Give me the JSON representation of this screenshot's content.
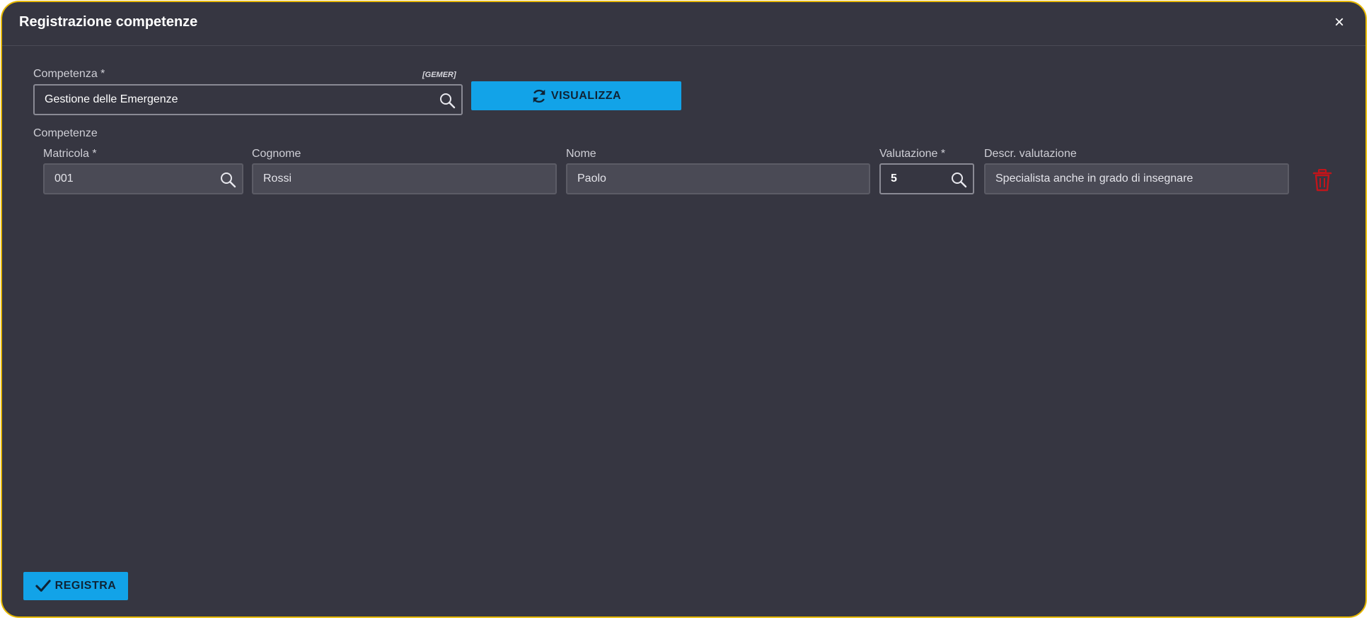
{
  "dialog": {
    "title": "Registrazione competenze",
    "close_label": "×"
  },
  "competenza": {
    "label": "Competenza *",
    "code": "[GEMER]",
    "value": "Gestione delle Emergenze",
    "search_icon": "search-icon"
  },
  "visualizza_button": {
    "label": "VISUALIZZA",
    "icon": "refresh-icon"
  },
  "section_label": "Competenze",
  "row": {
    "matricola": {
      "label": "Matricola *",
      "value": "001"
    },
    "cognome": {
      "label": "Cognome",
      "value": "Rossi"
    },
    "nome": {
      "label": "Nome",
      "value": "Paolo"
    },
    "valutazione": {
      "label": "Valutazione *",
      "value": "5"
    },
    "descr": {
      "label": "Descr. valutazione",
      "value": "Specialista anche in grado di insegnare"
    },
    "delete_icon": "trash-icon"
  },
  "registra_button": {
    "label": "REGISTRA",
    "icon": "check-icon"
  },
  "colors": {
    "background": "#363641",
    "accent": "#12a3e8",
    "border": "#e6b800",
    "delete": "#c0151b"
  }
}
